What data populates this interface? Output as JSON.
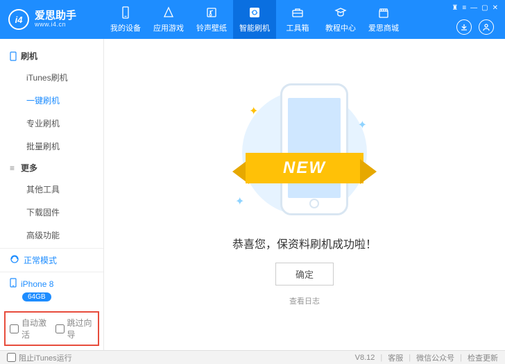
{
  "header": {
    "logo_text": "i4",
    "brand_name": "爱思助手",
    "brand_url": "www.i4.cn",
    "nav": [
      {
        "label": "我的设备"
      },
      {
        "label": "应用游戏"
      },
      {
        "label": "铃声壁纸"
      },
      {
        "label": "智能刷机"
      },
      {
        "label": "工具箱"
      },
      {
        "label": "教程中心"
      },
      {
        "label": "爱思商城"
      }
    ]
  },
  "sidebar": {
    "group1_title": "刷机",
    "group1_items": [
      "iTunes刷机",
      "一键刷机",
      "专业刷机",
      "批量刷机"
    ],
    "group2_title": "更多",
    "group2_items": [
      "其他工具",
      "下载固件",
      "高级功能"
    ],
    "mode_label": "正常模式",
    "device_name": "iPhone 8",
    "device_badge": "64GB",
    "options": {
      "auto_activate": "自动激活",
      "skip_guide": "跳过向导"
    }
  },
  "main": {
    "ribbon_text": "NEW",
    "success_text": "恭喜您，保资料刷机成功啦！",
    "ok_button": "确定",
    "log_link": "查看日志"
  },
  "footer": {
    "block_itunes": "阻止iTunes运行",
    "version": "V8.12",
    "support": "客服",
    "wechat": "微信公众号",
    "update": "检查更新"
  }
}
